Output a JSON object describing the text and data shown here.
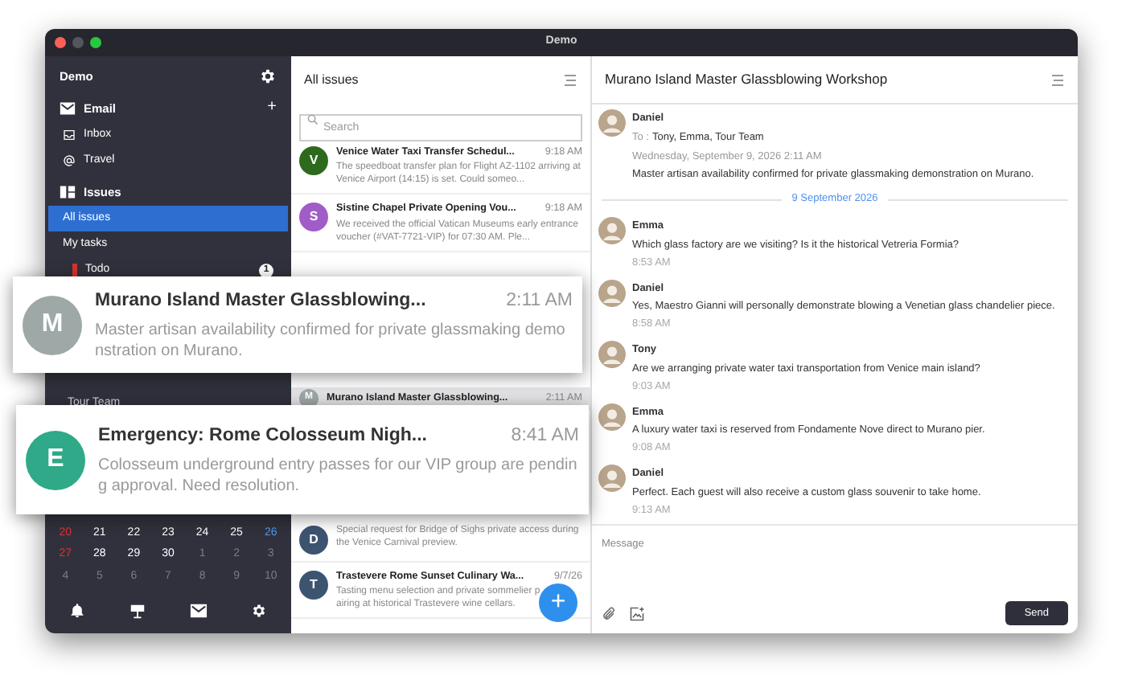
{
  "window": {
    "title": "Demo"
  },
  "sidebar": {
    "account": "Demo",
    "sections": [
      {
        "label": "Email",
        "action": "+",
        "items": [
          {
            "label": "Inbox",
            "selected": false
          },
          {
            "label": "Travel",
            "selected": false
          }
        ]
      },
      {
        "label": "Issues",
        "items": [
          {
            "label": "All issues",
            "selected": true
          },
          {
            "label": "My tasks",
            "selected": false
          },
          {
            "label": "Todo",
            "selected": false,
            "color": "#d9342b",
            "badge": "1"
          }
        ]
      }
    ],
    "team": "Tour Team",
    "calendar": {
      "weeks": [
        [
          {
            "day": "20",
            "kind": "sunday"
          },
          {
            "day": "21",
            "kind": "current"
          },
          {
            "day": "22",
            "kind": "current"
          },
          {
            "day": "23",
            "kind": "current"
          },
          {
            "day": "24",
            "kind": "current"
          },
          {
            "day": "25",
            "kind": "current"
          },
          {
            "day": "26",
            "kind": "saturday"
          }
        ],
        [
          {
            "day": "27",
            "kind": "sunday"
          },
          {
            "day": "28",
            "kind": "current"
          },
          {
            "day": "29",
            "kind": "current"
          },
          {
            "day": "30",
            "kind": "current"
          },
          {
            "day": "1",
            "kind": "other"
          },
          {
            "day": "2",
            "kind": "other"
          },
          {
            "day": "3",
            "kind": "other"
          }
        ],
        [
          {
            "day": "4",
            "kind": "other"
          },
          {
            "day": "5",
            "kind": "other"
          },
          {
            "day": "6",
            "kind": "other"
          },
          {
            "day": "7",
            "kind": "other"
          },
          {
            "day": "8",
            "kind": "other"
          },
          {
            "day": "9",
            "kind": "other"
          },
          {
            "day": "10",
            "kind": "other"
          }
        ]
      ]
    }
  },
  "list": {
    "title": "All issues",
    "search": {
      "placeholder": "Search"
    },
    "rows": [
      {
        "kind": "full",
        "letter": "V",
        "color": "#2d6a1e",
        "title": "Venice Water Taxi Transfer Schedul...",
        "time": "9:18 AM",
        "snippet": "The speedboat transfer plan for Flight AZ-1102 arriving at Venice Airport (14:15) is set. Could someo...",
        "selected": false
      },
      {
        "kind": "full",
        "letter": "S",
        "color": "#a05cc7",
        "title": "Sistine Chapel Private Opening Vou...",
        "time": "9:18 AM",
        "snippet": "We received the official Vatican Museums early entrance voucher (#VAT-7721-VIP) for 07:30 AM. Ple...",
        "selected": false
      },
      {
        "kind": "title_only",
        "letter": "M",
        "color": "#9ea8a7",
        "title": "Murano Island Master Glassblowing...",
        "time": "2:11 AM",
        "selected": true
      },
      {
        "kind": "snippet_only",
        "letter": "D",
        "color": "#3d5470",
        "snippet": "Special request for Bridge of Sighs private access during the Venice Carnival preview.",
        "selected": false
      },
      {
        "kind": "full",
        "letter": "T",
        "color": "#3d5470",
        "title": "Trastevere Rome Sunset Culinary Wa...",
        "time": "9/7/26",
        "snippet": "Tasting menu selection and private sommelier pairing at historical Trastevere wine cellars.",
        "selected": false
      }
    ],
    "fab": "+"
  },
  "chat": {
    "title": "Murano Island Master Glassblowing Workshop",
    "header": {
      "sender": "Daniel",
      "to_label": "To :",
      "recipients": "Tony, Emma, Tour Team",
      "date": "Wednesday, September 9, 2026 2:11 AM",
      "body": "Master artisan availability confirmed for private glassmaking demonstration on Murano."
    },
    "divider": "9 September 2026",
    "messages": [
      {
        "sender": "Emma",
        "text": "Which glass factory are we visiting? Is it the historical Vetreria Formia?",
        "time": "8:53 AM"
      },
      {
        "sender": "Daniel",
        "text": "Yes, Maestro Gianni will personally demonstrate blowing a Venetian glass chandelier piece.",
        "time": "8:58 AM"
      },
      {
        "sender": "Tony",
        "text": "Are we arranging private water taxi transportation from Venice main island?",
        "time": "9:03 AM"
      },
      {
        "sender": "Emma",
        "text": "A luxury water taxi is reserved from Fondamente Nove direct to Murano pier.",
        "time": "9:08 AM"
      },
      {
        "sender": "Daniel",
        "text": "Perfect. Each guest will also receive a custom glass souvenir to take home.",
        "time": "9:13 AM"
      }
    ],
    "composer": {
      "placeholder": "Message",
      "send": "Send"
    }
  },
  "notifications": [
    {
      "letter": "M",
      "color": "#9ea8a7",
      "title": "Murano Island Master Glassblowing...",
      "time": "2:11 AM",
      "snippet": "Master artisan availability confirmed for private glassmaking demonstration on Murano."
    },
    {
      "letter": "E",
      "color": "#2fa987",
      "title": "Emergency: Rome Colosseum Nigh...",
      "time": "8:41 AM",
      "snippet": "Colosseum underground entry passes for our VIP group are pending approval. Need resolution."
    }
  ]
}
